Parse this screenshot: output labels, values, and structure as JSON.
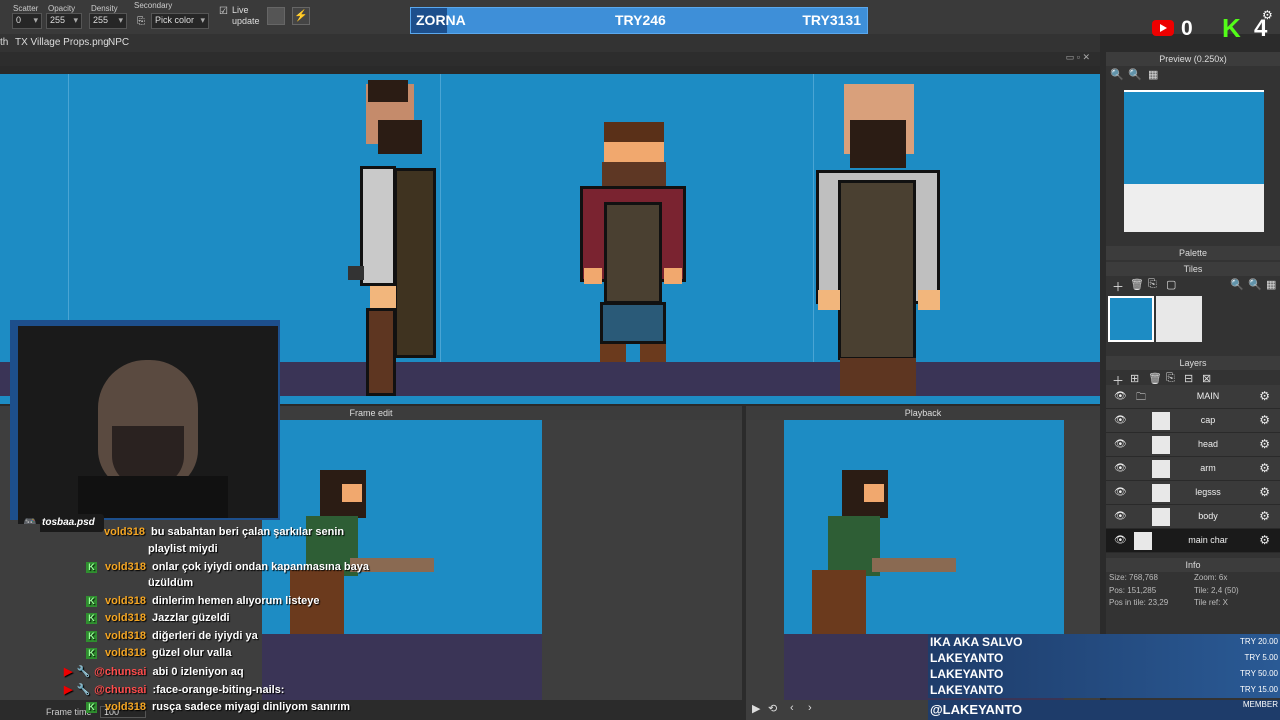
{
  "toolbar": {
    "scatter_label": "Scatter",
    "scatter_value": "0",
    "opacity_label": "Opacity",
    "opacity_value": "255",
    "density_label": "Density",
    "density_value": "255",
    "secondary_label": "Secondary",
    "secondary_value": "Pick color",
    "live_update_label_1": "Live",
    "live_update_label_2": "update"
  },
  "donation_bar": {
    "left": "ZORNA",
    "center": "TRY246",
    "right": "TRY3131",
    "fill_fraction": 0.08
  },
  "overlay_counts": {
    "youtube": "0",
    "kick": "4"
  },
  "file_tabs": [
    "th",
    "TX Village Props.png",
    "NPC"
  ],
  "panels": {
    "preview_title": "Preview (0.250x)",
    "palette_title": "Palette",
    "tiles_title": "Tiles",
    "layers_title": "Layers",
    "info_title": "Info",
    "frame_edit_title": "Frame edit",
    "playback_title": "Playback",
    "frame_time_label": "Frame time",
    "frame_time_value": "100"
  },
  "layers": [
    {
      "name": "MAIN"
    },
    {
      "name": "cap"
    },
    {
      "name": "head"
    },
    {
      "name": "arm"
    },
    {
      "name": "legsss"
    },
    {
      "name": "body"
    },
    {
      "name": "main char"
    }
  ],
  "info": {
    "size": "Size: 768,768",
    "zoom": "Zoom: 6x",
    "pos": "Pos: 151,285",
    "tile": "Tile: 2,4 (50)",
    "pos_in_tile": "Pos in tile: 23,29",
    "tile_ref": "Tile ref: X"
  },
  "discord": "tosbaa.psd",
  "chat": [
    {
      "user": "vold318",
      "text": "bu sabahtan beri çalan şarkılar senin"
    },
    {
      "user": "",
      "text": "playlist miydi"
    },
    {
      "user": "vold318",
      "text": "onlar çok iyiydi ondan kapanmasına baya"
    },
    {
      "user": "",
      "text": "üzüldüm"
    },
    {
      "user": "vold318",
      "text": "dinlerim hemen alıyorum listeye"
    },
    {
      "user": "vold318",
      "text": "Jazzlar güzeldi"
    },
    {
      "user": "vold318",
      "text": "diğerleri de iyiydi ya"
    },
    {
      "user": "vold318",
      "text": "güzel olur valla"
    },
    {
      "user": "@chunsai",
      "text": "abi 0 izleniyon aq"
    },
    {
      "user": "@chunsai",
      "text": ":face-orange-biting-nails:"
    },
    {
      "user": "vold318",
      "text": "rusça sadece miyagi dinliyom sanırım"
    }
  ],
  "donors": [
    {
      "name": "IKA AKA SALVO",
      "amount": "TRY 20.00"
    },
    {
      "name": "LAKEYANTO",
      "amount": "TRY 5.00"
    },
    {
      "name": "LAKEYANTO",
      "amount": "TRY 50.00"
    },
    {
      "name": "LAKEYANTO",
      "amount": "TRY 15.00"
    }
  ],
  "bottom_handle": "@LAKEYANTO",
  "member_label": "MEMBER",
  "colors": {
    "canvas": "#1d8cc4",
    "ground": "#3a3456",
    "accent_blue": "#3e8fd8"
  }
}
